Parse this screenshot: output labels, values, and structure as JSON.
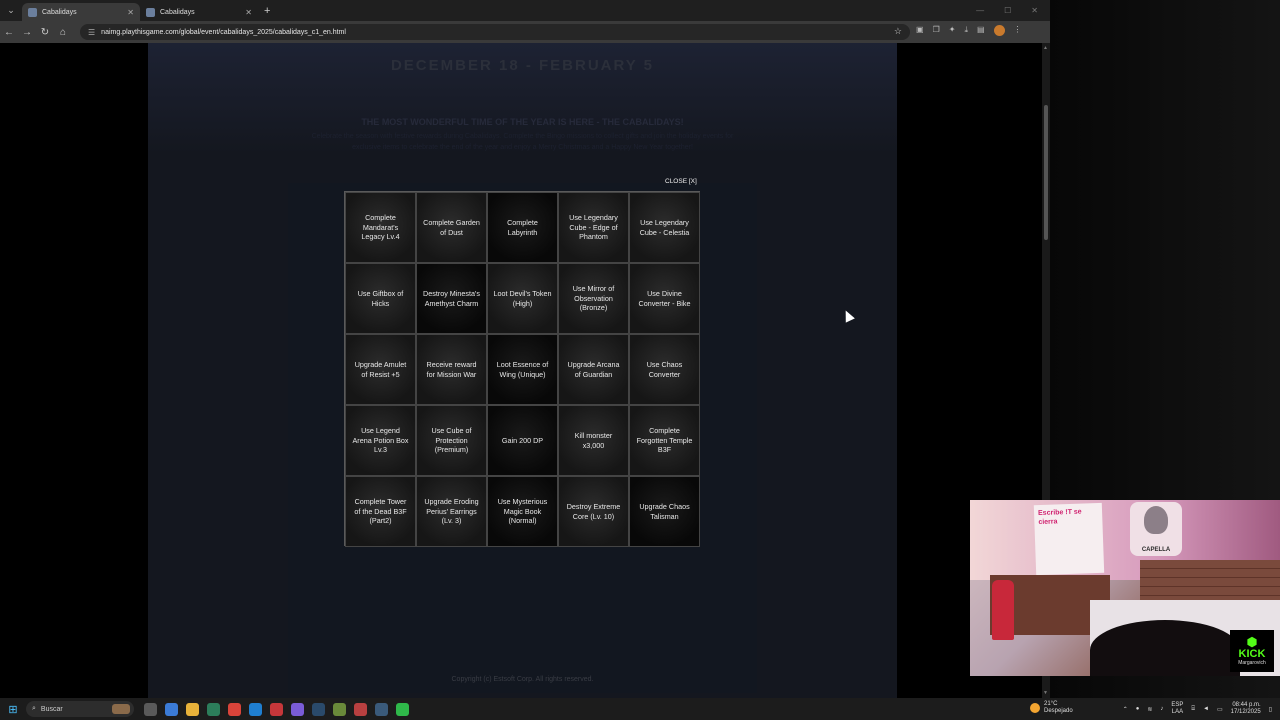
{
  "browser": {
    "tabs": [
      {
        "label": "Cabalidays",
        "active": true
      },
      {
        "label": "Cabalidays",
        "active": false
      }
    ],
    "url": "naimg.playthisgame.com/global/event/cabalidays_2025/cabalidays_c1_en.html"
  },
  "page": {
    "title": "DECEMBER 18 - FEBRUARY 5",
    "subtitle": "THE MOST WONDERFUL TIME OF THE YEAR IS HERE - THE CABALIDAYS!",
    "body": "Celebrate the season with festive rewards during Cabalidays. Complete the Bingo missions to collect gifts and join the holiday events for exclusive items to celebrate the end of the year and enjoy a Merry Christmas and a Happy New Year together!",
    "footer": "Copyright (c) Estsoft Corp. All rights reserved."
  },
  "modal": {
    "close_label": "CLOSE [X]",
    "cells": [
      "Complete Mandarat's Legacy Lv.4",
      "Complete Garden of Dust",
      "Complete Labyrinth",
      "Use Legendary Cube - Edge of Phantom",
      "Use Legendary Cube - Celestia",
      "Use Giftbox of Hicks",
      "Destroy Minesta's Amethyst Charm",
      "Loot Devil's Token (High)",
      "Use Mirror of Observation (Bronze)",
      "Use Divine Converter - Bike",
      "Upgrade Amulet of Resist +5",
      "Receive reward for Mission War",
      "Loot Essence of Wing (Unique)",
      "Upgrade Arcana of Guardian",
      "Use Chaos Converter",
      "Use Legend Arena Potion Box Lv.3",
      "Use Cube of Protection (Premium)",
      "Gain 200 DP",
      "Kill monster x3,000",
      "Complete Forgotten Temple B3F",
      "Complete Tower of the Dead B3F (Part2)",
      "Upgrade Eroding Perius' Earrings (Lv. 3)",
      "Use Mysterious Magic Book (Normal)",
      "Destroy Extreme Core (Lv. 10)",
      "Upgrade Chaos Talisman"
    ],
    "dark_cells": [
      2,
      6,
      12,
      17,
      22,
      24
    ]
  },
  "stream": {
    "note": "Escribe !T se cierra",
    "logo_label": "CAPELLA",
    "kick_brand": "KICK",
    "kick_user": "Margarovich"
  },
  "taskbar": {
    "search_label": "Buscar",
    "weather_temp": "21°C",
    "weather_desc": "Despejado",
    "lang_top": "ESP",
    "lang_bottom": "LAA",
    "time": "08:44 p.m.",
    "date": "17/12/2025"
  },
  "colors": {
    "kick_green": "#53fc18",
    "windows_blue": "#4cc2ff"
  },
  "icons": [
    "search-icon",
    "star-icon",
    "back-icon",
    "forward-icon",
    "reload-icon",
    "home-icon",
    "windows-start-icon"
  ]
}
